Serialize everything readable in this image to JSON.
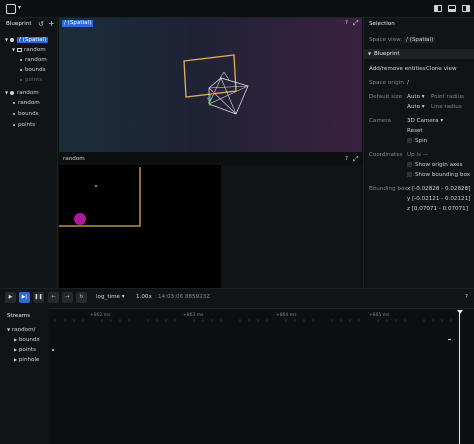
{
  "colors": {
    "accent": "#2a6bd6",
    "gold": "#e0b050",
    "magenta": "#b0179f"
  },
  "top": {
    "logo_icon": "rerun-logo-icon",
    "caret": "▾"
  },
  "blueprint_panel": {
    "title": "Blueprint",
    "tree": [
      {
        "label": "/ (Spatial)",
        "level": 0,
        "kind": "spatial",
        "selected": true
      },
      {
        "label": "random",
        "level": 1,
        "kind": "group"
      },
      {
        "label": "random",
        "level": 2,
        "kind": "entity"
      },
      {
        "label": "bounds",
        "level": 2,
        "kind": "entity"
      },
      {
        "label": "points",
        "level": 2,
        "kind": "entity",
        "dim": true
      },
      {
        "label": "random",
        "level": 0,
        "kind": "space"
      },
      {
        "label": "random",
        "level": 1,
        "kind": "entity"
      },
      {
        "label": "bounds",
        "level": 1,
        "kind": "entity"
      },
      {
        "label": "points",
        "level": 1,
        "kind": "entity"
      }
    ]
  },
  "viewport_top": {
    "tab": "/ (Spatial)",
    "help": "?"
  },
  "viewport_bottom": {
    "tab": "random",
    "help": "?"
  },
  "selection": {
    "title": "Selection",
    "space_view_label": "Space view:",
    "space_view_value": "/ (Spatial)",
    "blueprint_section": "Blueprint",
    "add_remove": "Add/remove entities",
    "clone_view": "Clone view",
    "space_origin_label": "Space origin",
    "space_origin_value": "/",
    "default_size_label": "Default size",
    "auto1": "Auto",
    "point_radius": "Point radius",
    "auto2": "Auto",
    "line_radius": "Line radius",
    "camera_label": "Camera",
    "camera_value": "3D Camera",
    "reset": "Reset",
    "spin": "Spin",
    "coords_label": "Coordinates",
    "up_is": "Up is —",
    "show_origin_axes": "Show origin axes",
    "show_bounding_box": "Show bounding box",
    "bbox_label": "Bounding box",
    "bbox_x": "x [-0.02828 - 0.02828]",
    "bbox_y": "y [-0.02121 - 0.02121]",
    "bbox_z": "z [0.07071 - 0.07071]"
  },
  "timeline": {
    "timeline_name": "log_time",
    "speed": "1.00x",
    "time": "14:03:06.885923Z",
    "help": "?",
    "ticks": [
      "+862 ms",
      "+863 ms",
      "+864 ms",
      "+865 ms"
    ]
  },
  "streams": {
    "title": "Streams",
    "items": [
      {
        "label": "random/",
        "level": 0
      },
      {
        "label": "bounds",
        "level": 1
      },
      {
        "label": "points",
        "level": 1
      },
      {
        "label": "pinhole",
        "level": 1
      }
    ]
  }
}
